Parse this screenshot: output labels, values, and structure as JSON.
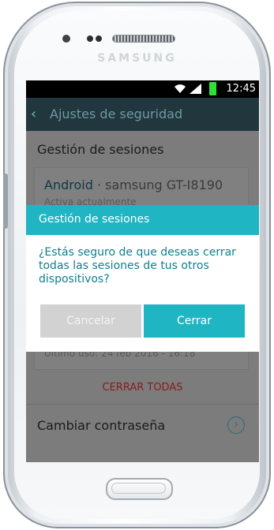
{
  "device": {
    "brand": "SAMSUNG"
  },
  "status_bar": {
    "time": "12:45"
  },
  "action_bar": {
    "back_icon": "chevron-left-icon",
    "title": "Ajustes de seguridad"
  },
  "sessions": {
    "header": "Gestión de sesiones",
    "device_os": "Android",
    "device_separator": "·",
    "device_model": "samsung GT-I8190",
    "status": "Activa actualmente",
    "last_use": "Último uso: 24 feb 2016 - 16:18",
    "close_all_label": "CERRAR TODAS"
  },
  "settings": {
    "change_password_label": "Cambiar contraseña",
    "change_password_icon": "chevron-right-circle-icon"
  },
  "dialog": {
    "title": "Gestión de sesiones",
    "message": "¿Estás seguro de que deseas cerrar todas las sesiones de tus otros dispositivos?",
    "cancel_label": "Cancelar",
    "confirm_label": "Cerrar"
  },
  "colors": {
    "accent": "#1fb5c3",
    "action_bar": "#21363d",
    "danger_text": "#8c1a1a",
    "battery": "#2ee03a"
  }
}
